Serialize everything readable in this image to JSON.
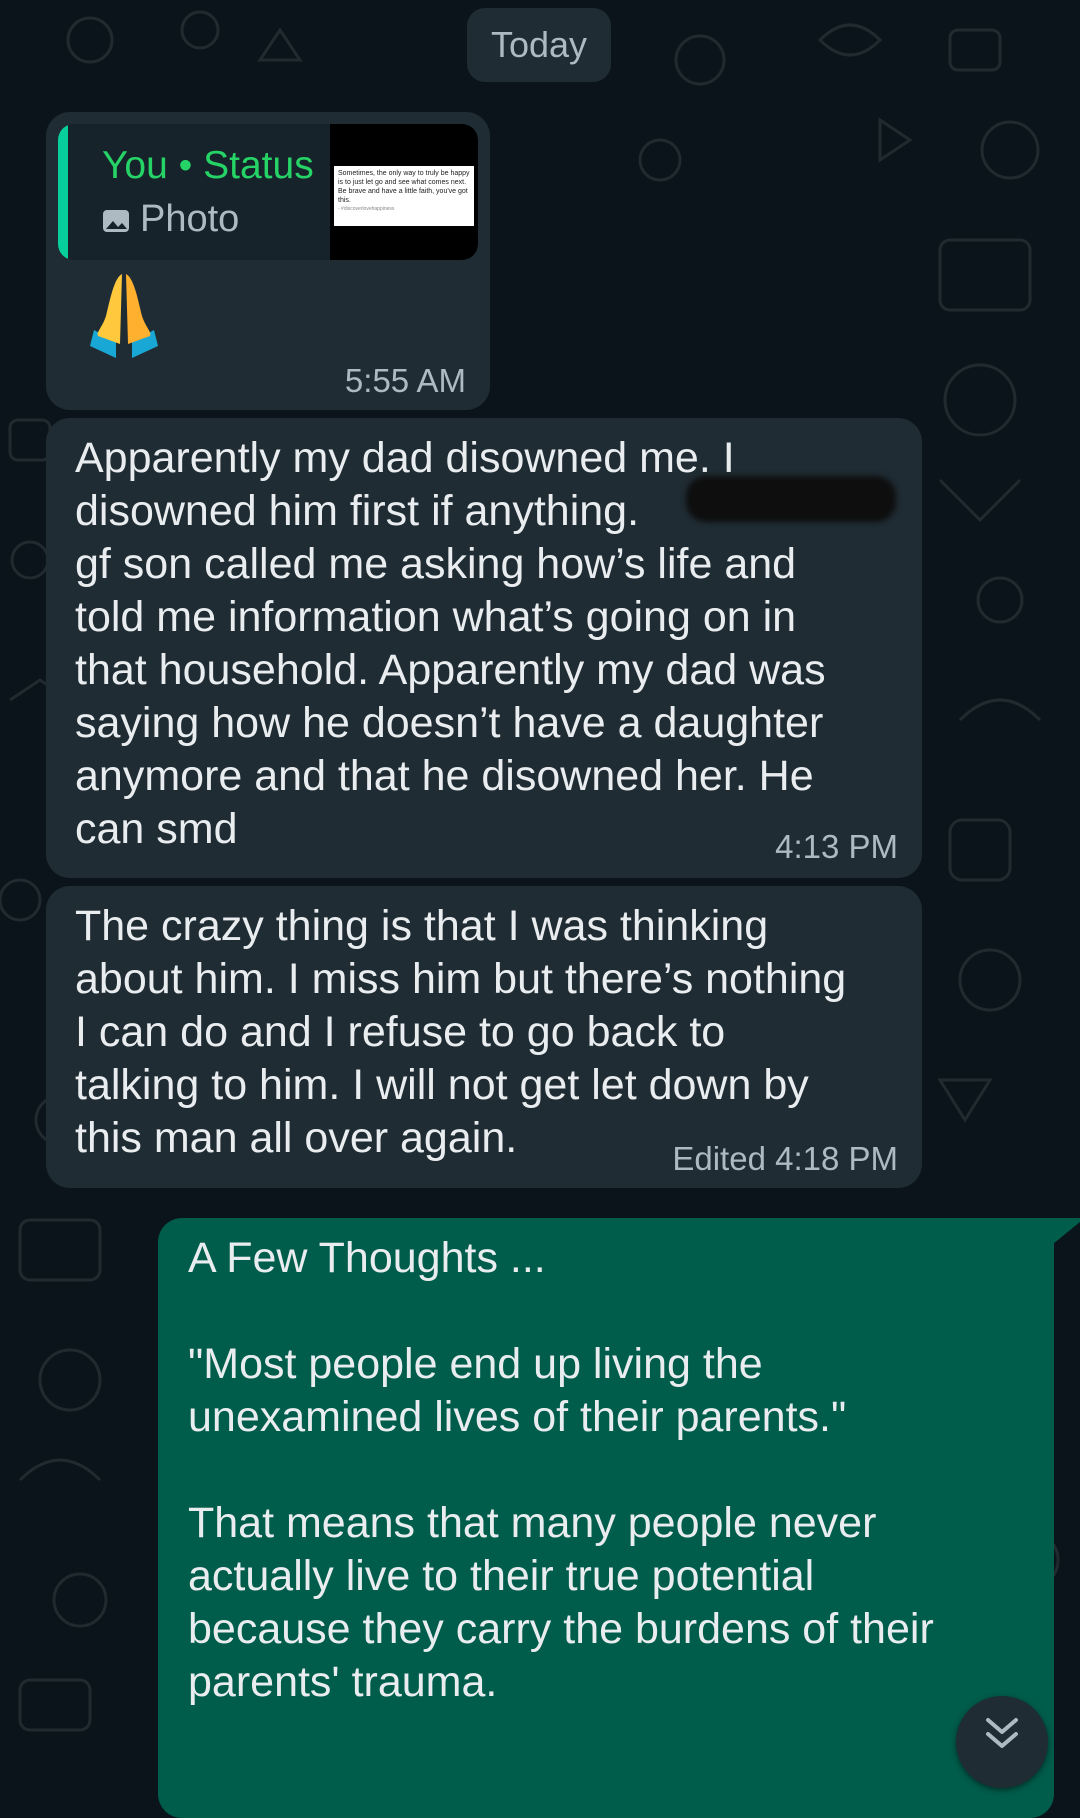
{
  "date_divider": "Today",
  "messages": [
    {
      "reply": {
        "title": "You • Status",
        "type_label": "Photo",
        "thumbnail_text": "Sometimes, the only way to truly be happy is to just let go and see what comes next. Be brave and have a little faith, you've got this.",
        "thumbnail_signature": "- #discoverlovehappiness"
      },
      "emoji": "folded-hands",
      "time": "5:55 AM"
    },
    {
      "text": "Apparently my dad disowned me. I\ndisowned him first if anything.\ngf son called me asking how’s life and\ntold me information what’s going on in\nthat household. Apparently my dad was\nsaying how he doesn’t have a daughter\nanymore and that he disowned her. He\ncan smd",
      "time": "4:13 PM"
    },
    {
      "text": "The crazy thing is that I was thinking\nabout him. I miss him but there’s nothing\nI can do and I refuse to go back to\ntalking to him. I will not get let down by\nthis man all over again.",
      "time": "Edited 4:18 PM"
    },
    {
      "text": "A Few Thoughts ...\n\n\"Most people end up living the\nunexamined lives of their parents.\"\n\nThat means that many people never\nactually live to their true potential\nbecause they carry the burdens of their\nparents' trauma."
    }
  ],
  "icons": {
    "scroll": "double-chevron-down-icon",
    "photo": "photo-icon"
  },
  "colors": {
    "background": "#0b141a",
    "incoming_bubble": "#1f2c33",
    "outgoing_bubble": "#005c4b",
    "accent": "#25d366",
    "meta": "#aebac1"
  }
}
